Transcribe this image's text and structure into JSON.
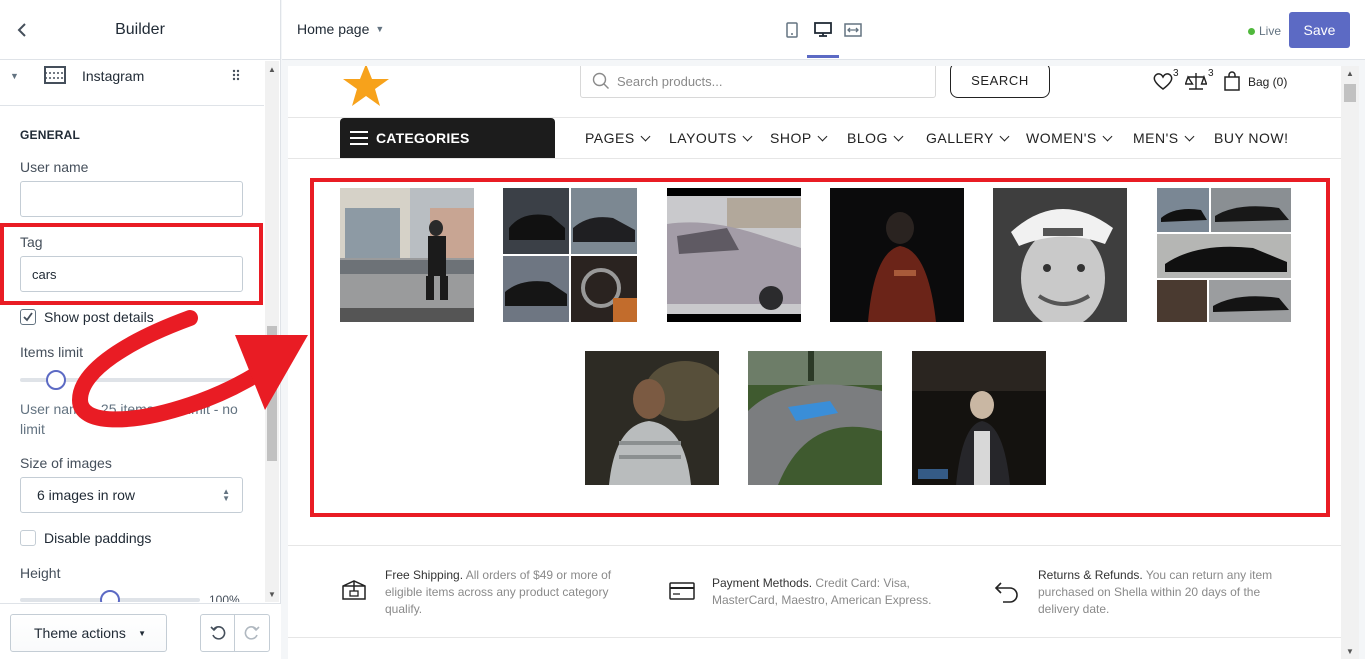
{
  "sidebar": {
    "title": "Builder",
    "block_label": "Instagram",
    "section_heading": "GENERAL",
    "username_label": "User name",
    "username_value": "",
    "tag_label": "Tag",
    "tag_value": "cars",
    "show_details_label": "Show post details",
    "show_details_checked": true,
    "items_limit_label": "Items limit",
    "items_limit_help": "User name - 25 items, tag limit - no limit",
    "size_label": "Size of images",
    "size_value": "6 images in row",
    "disable_paddings_label": "Disable paddings",
    "height_label": "Height",
    "height_value": "100%",
    "theme_actions_label": "Theme actions"
  },
  "topbar": {
    "page_select": "Home page",
    "live_label": "Live",
    "save_label": "Save"
  },
  "store": {
    "search_placeholder": "Search products...",
    "search_button": "SEARCH",
    "wishlist_count": "3",
    "compare_count": "3",
    "bag_label": "Bag (0)",
    "categories_label": "CATEGORIES",
    "nav": [
      "PAGES",
      "LAYOUTS",
      "SHOP",
      "BLOG",
      "GALLERY",
      "WOMEN'S",
      "MEN'S",
      "BUY NOW!"
    ],
    "features": [
      {
        "title": "Free Shipping.",
        "text": " All orders of $49 or more of eligible items across any product category qualify."
      },
      {
        "title": "Payment Methods.",
        "text": " Credit Card: Visa, MasterCard, Maestro, American Express."
      },
      {
        "title": "Returns & Refunds.",
        "text": " You can return any item purchased on Shella within 20 days of the delivery date."
      }
    ]
  },
  "instagram_photos": [
    "street-crossing",
    "bmw-collage",
    "silver-car",
    "hooded-person",
    "racing-cap-portrait",
    "black-sedan-collage",
    "young-man-portrait",
    "blue-car-drifting",
    "fast-and-furious-still"
  ],
  "colors": {
    "accent": "#5c6ac4",
    "highlight_red": "#e91c24",
    "live_green": "#50b83c",
    "star": "#f7a21b"
  }
}
